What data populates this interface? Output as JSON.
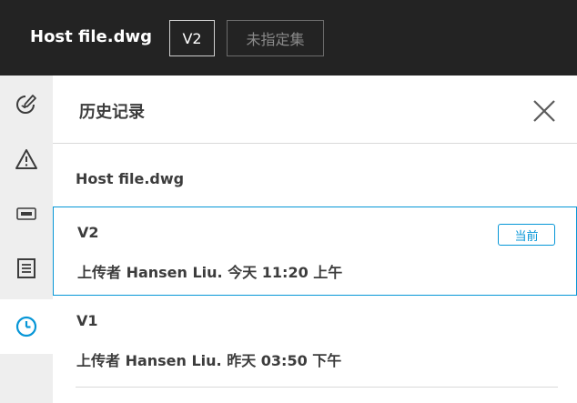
{
  "header": {
    "file_title": "Host file.dwg",
    "version_badge": "V2",
    "set_badge": "未指定集"
  },
  "rail": {
    "items": [
      {
        "icon": "markup-pen-icon"
      },
      {
        "icon": "warning-icon"
      },
      {
        "icon": "rfi-icon"
      },
      {
        "icon": "sheets-icon"
      },
      {
        "icon": "history-clock-icon",
        "active": true
      }
    ]
  },
  "panel": {
    "title": "历史记录",
    "file_name": "Host file.dwg",
    "versions": [
      {
        "label": "V2",
        "meta": "上传者 Hansen Liu. 今天 11:20 上午",
        "current_label": "当前"
      },
      {
        "label": "V1",
        "meta": "上传者 Hansen Liu. 昨天 03:50 下午"
      }
    ]
  },
  "colors": {
    "header_bg": "#232323",
    "accent": "#0696d7",
    "rail_bg": "#eeeeee"
  }
}
